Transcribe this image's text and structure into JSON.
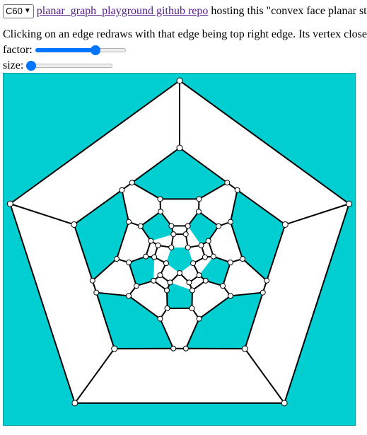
{
  "controls": {
    "graph_select": {
      "selected": "C60",
      "icon": "chevron-down-icon"
    },
    "repo_link_text": "planar_graph_playground github repo",
    "hosting_text": "hosting this \"convex face planar st",
    "instructions": "Clicking on an edge redraws with that edge being top right edge. Its vertex close",
    "factor_label": "factor:",
    "factor_value_fraction": 0.69,
    "size_label": "size:",
    "size_value_fraction": 0.0
  },
  "drawing": {
    "background_color": "#00ced1",
    "face_fill": "#ffffff",
    "highlight_fill": "#00ced1",
    "edge_color": "#000000",
    "vertex_fill": "#ffffff",
    "graph": "C60"
  }
}
